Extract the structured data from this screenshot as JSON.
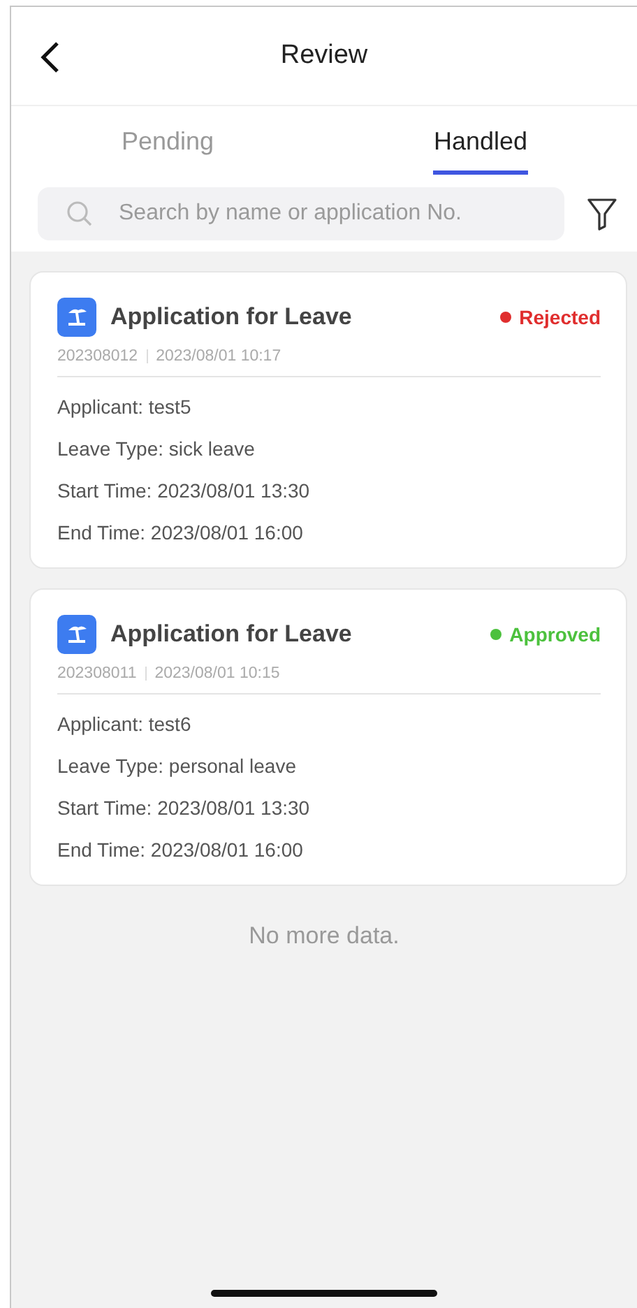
{
  "header": {
    "title": "Review"
  },
  "tabs": [
    {
      "label": "Pending",
      "selected": false
    },
    {
      "label": "Handled",
      "selected": true
    }
  ],
  "search": {
    "placeholder": "Search by name or application No."
  },
  "cards": [
    {
      "title": "Application for Leave",
      "status": "Rejected",
      "color": "#e02e2e",
      "number": "202308012",
      "submitted": "2023/08/01 10:17",
      "fields": [
        "Applicant: test5",
        "Leave Type: sick leave",
        "Start Time: 2023/08/01 13:30",
        "End Time: 2023/08/01 16:00"
      ]
    },
    {
      "title": "Application for Leave",
      "status": "Approved",
      "color": "#4cc13d",
      "number": "202308011",
      "submitted": "2023/08/01 10:15",
      "fields": [
        "Applicant: test6",
        "Leave Type: personal leave",
        "Start Time: 2023/08/01 13:30",
        "End Time: 2023/08/01 16:00"
      ]
    }
  ],
  "footer_note": "No more data."
}
